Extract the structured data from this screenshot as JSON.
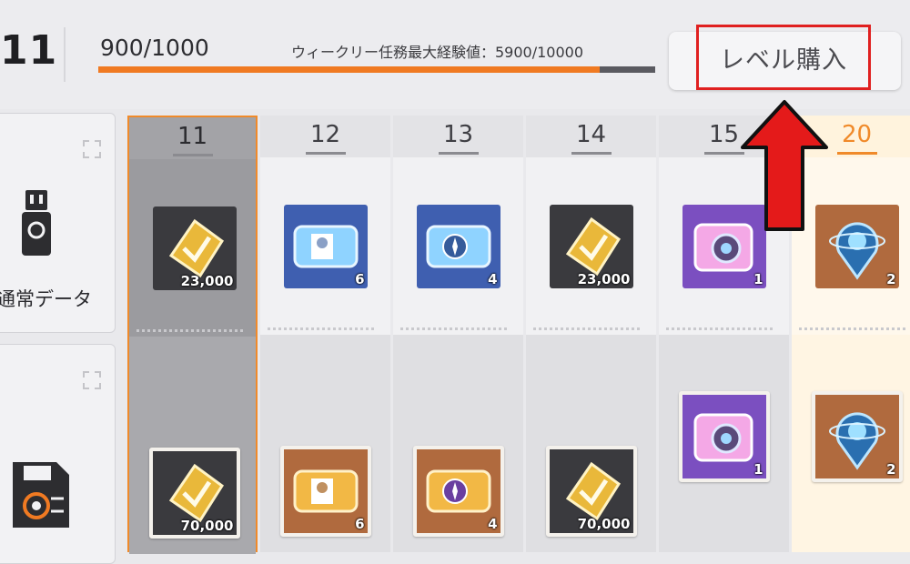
{
  "header": {
    "current_level": "11",
    "exp": "900/1000",
    "exp_fraction": 0.9,
    "weekly_label": "ウィークリー任務最大経験値：5900/10000",
    "buy_button_label": "レベル購入"
  },
  "left_panel": {
    "tier1_label": "通常データ"
  },
  "columns": [
    {
      "level": "11",
      "current": true,
      "top": {
        "icon": "gold-ticket-icon",
        "qty": "23,000",
        "bg": "#3a3a3e"
      },
      "bottom": {
        "icon": "gold-ticket-icon",
        "qty": "70,000",
        "bg": "#3a3a3e"
      }
    },
    {
      "level": "12",
      "top": {
        "icon": "blue-pass-icon",
        "qty": "6",
        "bg": "#3f5fb0"
      },
      "bottom": {
        "icon": "gold-pass-icon",
        "qty": "6",
        "bg": "#b06a3e"
      }
    },
    {
      "level": "13",
      "top": {
        "icon": "blue-compass-pass-icon",
        "qty": "4",
        "bg": "#3f5fb0"
      },
      "bottom": {
        "icon": "gold-compass-pass-icon",
        "qty": "4",
        "bg": "#b06a3e"
      }
    },
    {
      "level": "14",
      "top": {
        "icon": "gold-ticket-icon",
        "qty": "23,000",
        "bg": "#3a3a3e"
      },
      "bottom": {
        "icon": "gold-ticket-icon",
        "qty": "70,000",
        "bg": "#3a3a3e"
      }
    },
    {
      "level": "15",
      "top": {
        "icon": "pink-camera-icon",
        "qty": "1",
        "bg": "#7b4fc0"
      },
      "bottom": {
        "icon": "pink-camera-icon",
        "qty": "1",
        "bg": "#7b4fc0"
      }
    },
    {
      "level": "20",
      "top": {
        "icon": "orb-pin-icon",
        "qty": "2",
        "bg": "#b06a3e"
      },
      "bottom": {
        "icon": "orb-pin-icon",
        "qty": "2",
        "bg": "#b06a3e"
      }
    }
  ],
  "colors": {
    "accent": "#f07a22",
    "highlight": "#e02020"
  }
}
